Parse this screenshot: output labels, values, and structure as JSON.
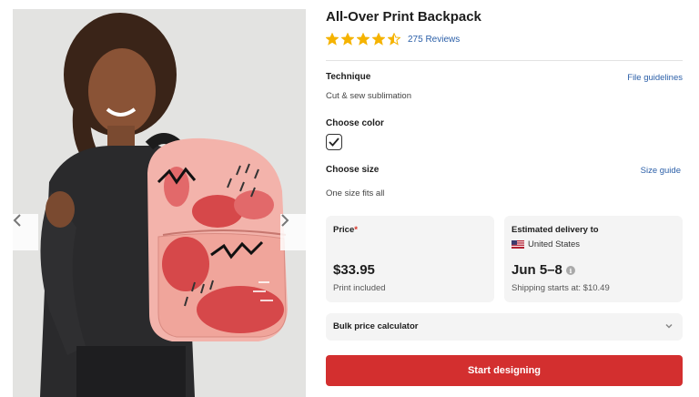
{
  "product": {
    "title": "All-Over Print Backpack",
    "rating": 4.5,
    "rating_max": 5,
    "reviews_label": "275 Reviews"
  },
  "gallery": {
    "image": "girl-with-pink-backpack-photo",
    "prev_icon": "chevron-left-icon",
    "next_icon": "chevron-right-icon"
  },
  "technique": {
    "label": "Technique",
    "value": "Cut & sew sublimation",
    "link": "File guidelines"
  },
  "color": {
    "label": "Choose color",
    "selected_icon": "check-icon"
  },
  "size": {
    "label": "Choose size",
    "link": "Size guide",
    "value": "One size fits all"
  },
  "price_card": {
    "title": "Price",
    "required_mark": "*",
    "price": "$33.95",
    "note": "Print included"
  },
  "delivery_card": {
    "title": "Estimated delivery to",
    "country": "United States",
    "flag_icon": "us-flag-icon",
    "dates": "Jun 5–8",
    "info_icon": "i",
    "shipping": "Shipping starts at: $10.49"
  },
  "bulk": {
    "label": "Bulk price calculator",
    "icon": "chevron-down-icon"
  },
  "cta": {
    "label": "Start designing"
  },
  "colors": {
    "accent": "#d32f2f",
    "link": "#2b5fa8",
    "star": "#f5b301",
    "card_bg": "#f4f4f4"
  }
}
